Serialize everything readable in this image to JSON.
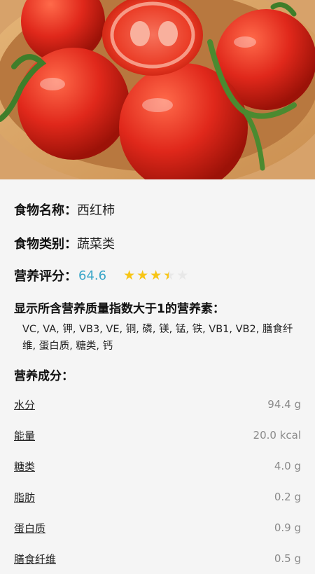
{
  "food": {
    "name_label": "食物名称：",
    "name_value": "西红柿",
    "category_label": "食物类别：",
    "category_value": "蔬菜类",
    "score_label": "营养评分：",
    "score_value": "64.6",
    "stars_rating": 3.5,
    "stars_max": 5
  },
  "nutrients": {
    "heading": "显示所含营养质量指数大于1的营养素：",
    "list_text": "VC, VA, 钾, VB3, VE, 铜, 磷, 镁, 锰, 铁, VB1, VB2, 膳食纤维, 蛋白质, 糖类, 钙"
  },
  "composition": {
    "heading": "营养成分：",
    "rows": [
      {
        "name": "水分",
        "value": "94.4 g"
      },
      {
        "name": "能量",
        "value": "20.0 kcal"
      },
      {
        "name": "糖类",
        "value": "4.0 g"
      },
      {
        "name": "脂肪",
        "value": "0.2 g"
      },
      {
        "name": "蛋白质",
        "value": "0.9 g"
      },
      {
        "name": "膳食纤维",
        "value": "0.5 g"
      }
    ]
  },
  "colors": {
    "score": "#3aa6c8",
    "star_full": "#f7c515",
    "star_empty": "#e8e8e8",
    "background": "#f5f5f5"
  }
}
